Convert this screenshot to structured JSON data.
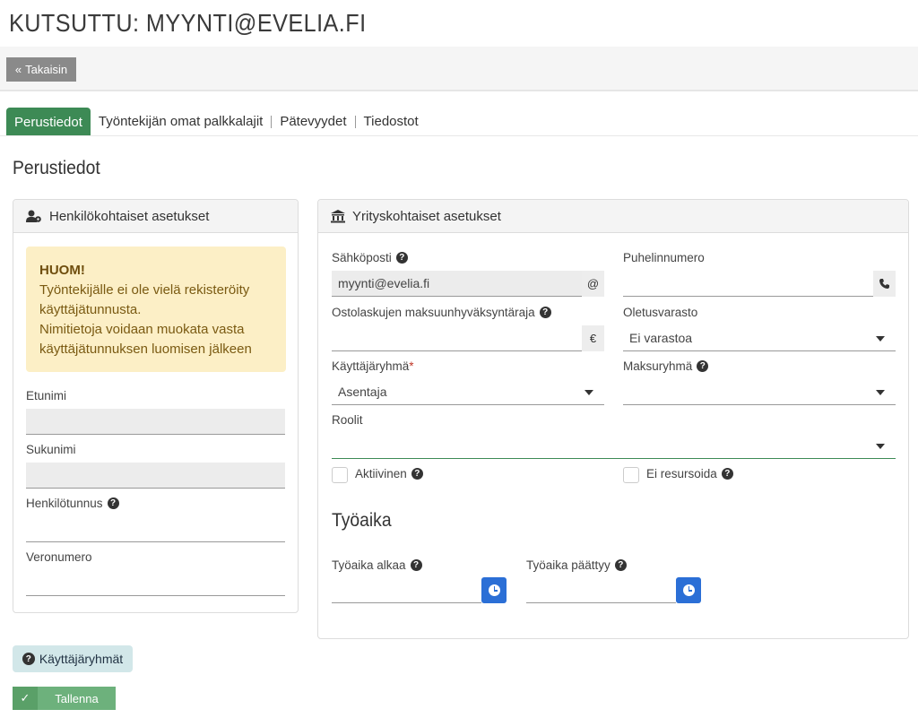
{
  "page": {
    "title": "KUTSUTTU: MYYNTI@EVELIA.FI"
  },
  "toolbar": {
    "back_label": "Takaisin"
  },
  "tabs": [
    {
      "label": "Perustiedot",
      "active": true
    },
    {
      "label": "Työntekijän omat palkkalajit",
      "active": false
    },
    {
      "label": "Pätevyydet",
      "active": false
    },
    {
      "label": "Tiedostot",
      "active": false
    }
  ],
  "section_title": "Perustiedot",
  "personal": {
    "heading": "Henkilökohtaiset asetukset",
    "notice_title": "HUOM!",
    "notice_line1": "Työntekijälle ei ole vielä rekisteröity käyttäjätunnusta.",
    "notice_line2": "Nimitietoja voidaan muokata vasta käyttäjätunnuksen luomisen jälkeen",
    "first_name_label": "Etunimi",
    "first_name_value": "",
    "last_name_label": "Sukunimi",
    "last_name_value": "",
    "ssn_label": "Henkilötunnus",
    "ssn_value": "",
    "tax_label": "Veronumero",
    "tax_value": ""
  },
  "company": {
    "heading": "Yrityskohtaiset asetukset",
    "email_label": "Sähköposti",
    "email_value": "myynti@evelia.fi",
    "email_addon": "@",
    "phone_label": "Puhelinnumero",
    "phone_value": "",
    "approval_label": "Ostolaskujen maksuunhyväksyntäraja",
    "approval_value": "",
    "currency_addon": "€",
    "warehouse_label": "Oletusvarasto",
    "warehouse_value": "Ei varastoa",
    "usergroup_label": "Käyttäjäryhmä",
    "usergroup_required": "*",
    "usergroup_value": "Asentaja",
    "paygroup_label": "Maksuryhmä",
    "paygroup_value": "",
    "roles_label": "Roolit",
    "roles_value": "",
    "active_label": "Aktiivinen",
    "active_checked": false,
    "noresource_label": "Ei resursoida",
    "noresource_checked": false,
    "worktime_title": "Työaika",
    "start_label": "Työaika alkaa",
    "start_value": "",
    "end_label": "Työaika päättyy",
    "end_value": ""
  },
  "buttons": {
    "user_groups": "Käyttäjäryhmät",
    "save": "Tallenna"
  },
  "colors": {
    "accent_green": "#3d8a55",
    "clock_blue": "#2b6fd6",
    "notice_bg": "#fcefc6"
  }
}
